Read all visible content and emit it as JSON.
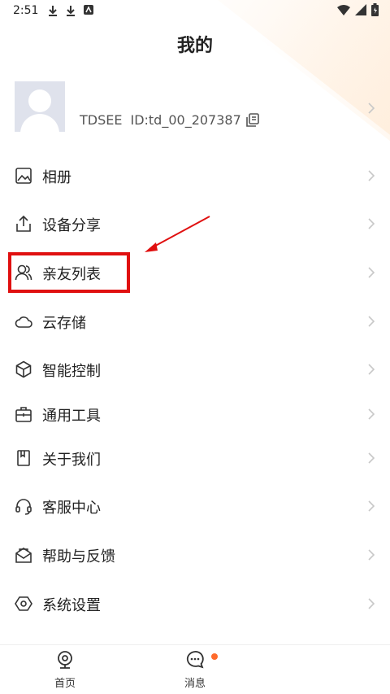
{
  "status_bar": {
    "time": "2:51"
  },
  "page": {
    "title": "我的"
  },
  "profile": {
    "name": "TDSEE",
    "id": "ID:td_00_207387"
  },
  "menu": [
    {
      "label": "相册",
      "icon": "photo-icon"
    },
    {
      "label": "设备分享",
      "icon": "share-icon"
    },
    {
      "label": "亲友列表",
      "icon": "contacts-icon"
    },
    {
      "label": "云存储",
      "icon": "cloud-icon"
    },
    {
      "label": "智能控制",
      "icon": "cube-icon"
    },
    {
      "label": "通用工具",
      "icon": "toolbox-icon"
    },
    {
      "label": "关于我们",
      "icon": "bookmark-icon"
    },
    {
      "label": "客服中心",
      "icon": "headset-icon"
    },
    {
      "label": "帮助与反馈",
      "icon": "feedback-mail-icon"
    },
    {
      "label": "系统设置",
      "icon": "settings-hexagon-icon"
    }
  ],
  "tabs": [
    {
      "label": "首页",
      "icon": "camera-home-icon"
    },
    {
      "label": "消息",
      "icon": "chat-bubble-icon",
      "has_badge": true
    }
  ],
  "colors": {
    "annotation": "#e01010",
    "badge": "#ff6a2b",
    "chevron": "#c8c8c8",
    "icon": "#333333"
  }
}
